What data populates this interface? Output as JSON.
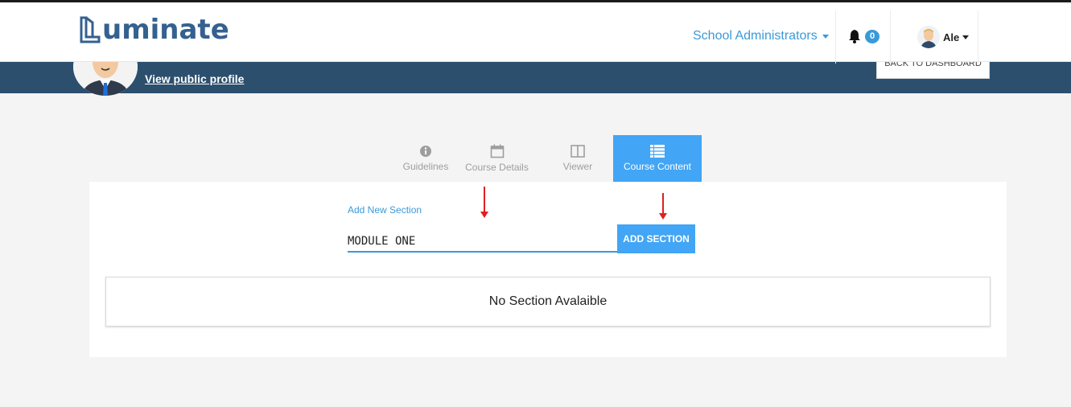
{
  "header": {
    "logo_text": "uminate",
    "role_label": "School Administrators",
    "notification_count": "0",
    "user_name": "Ale"
  },
  "profile": {
    "view_public_profile": "View public profile",
    "back_to_dashboard": "BACK TO DASHBOARD"
  },
  "tabs": [
    {
      "label": "Guidelines",
      "icon": "info-icon",
      "active": false
    },
    {
      "label": "Course Details",
      "icon": "calendar-icon",
      "active": false
    },
    {
      "label": "Viewer",
      "icon": "columns-icon",
      "active": false
    },
    {
      "label": "Course Content",
      "icon": "list-icon",
      "active": true
    }
  ],
  "section_form": {
    "label": "Add New Section",
    "value": "MODULE ONE",
    "button_label": "ADD SECTION"
  },
  "sections": {
    "empty_message": "No Section Avalaible"
  },
  "colors": {
    "accent": "#42a5f5",
    "banner": "#2c4f6e",
    "logo": "#34618f",
    "annotation_arrow": "#e02020"
  }
}
